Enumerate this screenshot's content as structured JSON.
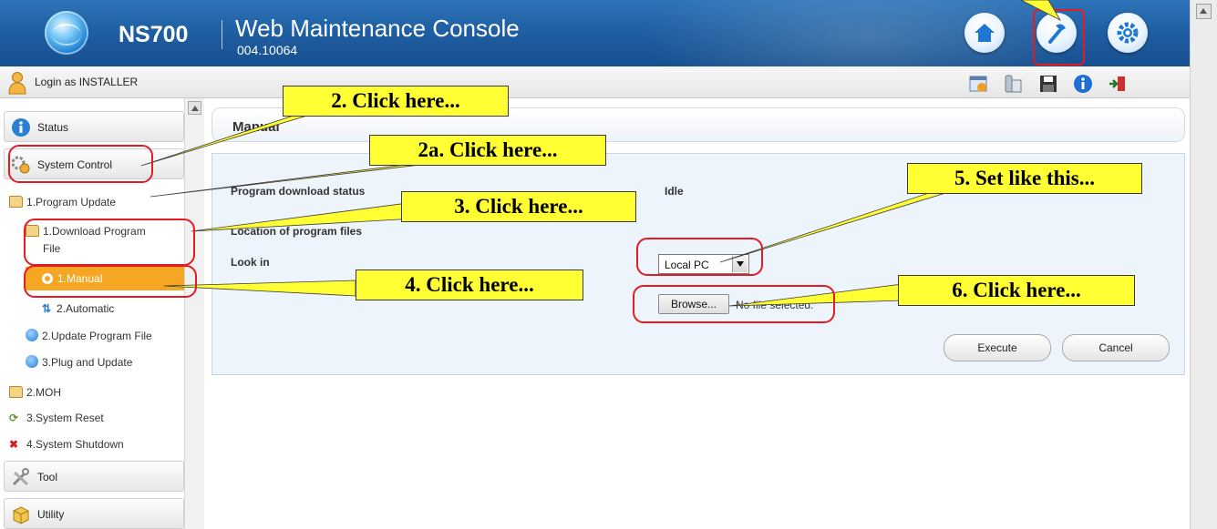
{
  "header": {
    "product": "NS700",
    "title": "Web Maintenance Console",
    "version": "004.10064",
    "buttons": [
      {
        "name": "home",
        "icon": "home-icon"
      },
      {
        "name": "maintenance",
        "icon": "wrench-icon"
      },
      {
        "name": "setup",
        "icon": "gear-icon"
      }
    ]
  },
  "loginbar": {
    "text": "Login as INSTALLER",
    "tools": [
      "calendar-icon",
      "phone-icon",
      "save-icon",
      "info-icon",
      "logout-icon"
    ]
  },
  "sidebar": {
    "status": "Status",
    "system_control": "System Control",
    "tree": {
      "program_update": "1.Program Update",
      "download_program_file_line1": "1.Download Program",
      "download_program_file_line2": "File",
      "manual": "1.Manual",
      "automatic": "2.Automatic",
      "update_program_file": "2.Update Program File",
      "plug_and_update": "3.Plug and Update",
      "moh": "2.MOH",
      "system_reset": "3.System Reset",
      "system_shutdown": "4.System Shutdown"
    },
    "tool": "Tool",
    "utility": "Utility"
  },
  "main": {
    "page_title": "Manual",
    "program_download_status_label": "Program download status",
    "program_download_status_value": "Idle",
    "location_label": "Location of program files",
    "look_in_label": "Look in",
    "look_in_value": "Local PC",
    "browse_label": "Browse...",
    "file_status": "No file selected.",
    "execute_label": "Execute",
    "cancel_label": "Cancel"
  },
  "annotations": {
    "step2": "2. Click here...",
    "step2a": "2a. Click here...",
    "step3": "3. Click here...",
    "step4": "4. Click here...",
    "step5": "5. Set like this...",
    "step6": "6. Click here..."
  },
  "colors": {
    "header_blue": "#1f5fa3",
    "selected_orange": "#f5a623",
    "callout_yellow": "#ffff33",
    "annotation_red": "#e31b23"
  }
}
